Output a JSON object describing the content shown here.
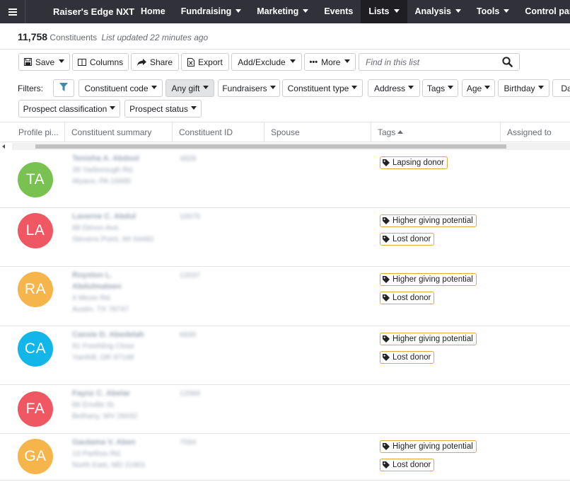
{
  "nav": {
    "brand": "Raiser's Edge NXT",
    "items": [
      {
        "label": "Home",
        "caret": false,
        "active": false
      },
      {
        "label": "Fundraising",
        "caret": true,
        "active": false
      },
      {
        "label": "Marketing",
        "caret": true,
        "active": false
      },
      {
        "label": "Events",
        "caret": false,
        "active": false
      },
      {
        "label": "Lists",
        "caret": true,
        "active": true
      },
      {
        "label": "Analysis",
        "caret": true,
        "active": false
      },
      {
        "label": "Tools",
        "caret": true,
        "active": false
      },
      {
        "label": "Control panel",
        "caret": true,
        "active": false
      }
    ]
  },
  "summary": {
    "count": "11,758",
    "count_label": "Constituents",
    "updated": "List updated 22 minutes ago"
  },
  "toolbar": {
    "save": "Save",
    "columns": "Columns",
    "share": "Share",
    "export": "Export",
    "add_exclude": "Add/Exclude",
    "more": "More",
    "search_placeholder": "Find in this list"
  },
  "filters": {
    "label": "Filters:",
    "items": [
      {
        "label": "Constituent code",
        "selected": false
      },
      {
        "label": "Any gift",
        "selected": true
      },
      {
        "label": "Fundraisers",
        "selected": false
      },
      {
        "label": "Constituent type",
        "selected": false
      },
      {
        "label": "Address",
        "selected": false
      },
      {
        "label": "Tags",
        "selected": false
      },
      {
        "label": "Age",
        "selected": false
      },
      {
        "label": "Birthday",
        "selected": false
      },
      {
        "label": "Da",
        "selected": false
      },
      {
        "label": "Prospect classification",
        "selected": false
      },
      {
        "label": "Prospect status",
        "selected": false
      }
    ]
  },
  "columns": [
    "Profile pi...",
    "Constituent summary",
    "Constituent ID",
    "Spouse",
    "Tags",
    "Assigned to"
  ],
  "rows": [
    {
      "initials": "TA",
      "color": "#79c150",
      "name": "Tenisha A. Abdool",
      "address1": "39 Yarborough Rd.",
      "address2": "Wyano, PA 15695",
      "id": "4828",
      "tags": [
        "Lapsing donor"
      ]
    },
    {
      "initials": "LA",
      "color": "#ef5763",
      "name": "Laverne C. Abdul",
      "address1": "88 Dimon Ave.",
      "address2": "Stevens Point, WI 54482",
      "id": "10075",
      "tags": [
        "Higher giving potential",
        "Lost donor"
      ]
    },
    {
      "initials": "RA",
      "color": "#f6b54b",
      "name": "Royston L.",
      "name2": "Abdulmateen",
      "address1": "4 Micon Rd.",
      "address2": "Austin, TX 78747",
      "id": "12037",
      "tags": [
        "Higher giving potential",
        "Lost donor"
      ]
    },
    {
      "initials": "CA",
      "color": "#12b6e9",
      "name": "Cassie D. Abedelah",
      "address1": "91 Freehling Close",
      "address2": "Yamhill, OR 97148",
      "id": "6930",
      "tags": [
        "Higher giving potential",
        "Lost donor"
      ]
    },
    {
      "initials": "FA",
      "color": "#ef5763",
      "name": "Faynz C. Abelar",
      "address1": "86 Enville St.",
      "address2": "Bethany, WV 26032",
      "id": "12066",
      "tags": []
    },
    {
      "initials": "GA",
      "color": "#f6b54b",
      "name": "Gautama V. Aben",
      "address1": "13 Parthos Rd.",
      "address2": "North East, MD 21901",
      "id": "7594",
      "tags": [
        "Higher giving potential",
        "Lost donor"
      ]
    }
  ]
}
